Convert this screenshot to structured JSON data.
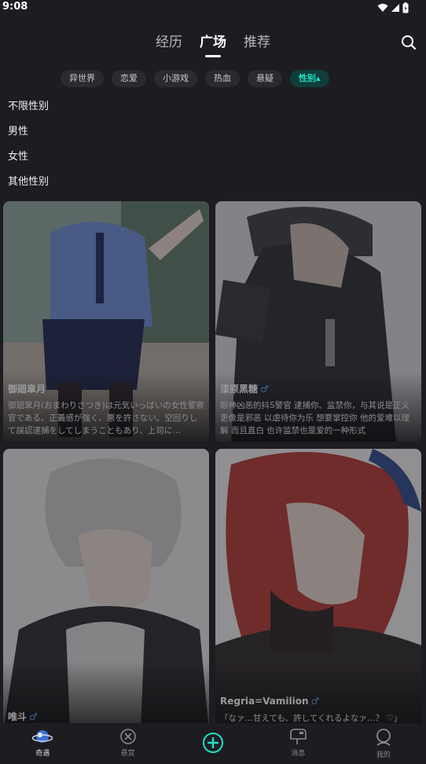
{
  "status": {
    "time": "9:08"
  },
  "tabs": [
    {
      "label": "经历"
    },
    {
      "label": "广场"
    },
    {
      "label": "推荐"
    }
  ],
  "chips": [
    {
      "label": "异世界"
    },
    {
      "label": "恋爱"
    },
    {
      "label": "小游戏"
    },
    {
      "label": "热血"
    },
    {
      "label": "悬疑"
    },
    {
      "label": "性别▴"
    }
  ],
  "gender_menu": {
    "options": [
      "不限性别",
      "男性",
      "女性",
      "其他性别"
    ]
  },
  "cards": [
    {
      "name": "御廻皐月",
      "gender": "",
      "desc": "御廻皐月(おまわりさつき)は元気いっぱいの女性警察官である。正義感が強く、悪を許さない。空回りして誤認逮捕をしてしまうこともあり、上司に…"
    },
    {
      "name": "漆原黑糖",
      "gender": "♂",
      "desc": "眼神凶恶的抖S警官 逮捕你、监禁你，与其说是正义更像是邪恶 以虐待你为乐 想要掌控你 他的爱难以理解 而且直白 也许监禁也是爱的一种形式"
    },
    {
      "name": "唯斗",
      "gender": "♂",
      "desc": ""
    },
    {
      "name": "Regria=Vamilion",
      "gender": "♂",
      "desc": "「なァ…甘えても、許してくれるよなァ…？ ♡」"
    }
  ],
  "bottom_nav": [
    {
      "label": "奇遇",
      "icon": "planet-icon"
    },
    {
      "label": "悬赏",
      "icon": "bounty-icon"
    },
    {
      "label": "",
      "icon": "plus-circle-icon"
    },
    {
      "label": "消息",
      "icon": "mailbox-icon"
    },
    {
      "label": "我的",
      "icon": "profile-icon"
    }
  ],
  "colors": {
    "background": "#1d1c21",
    "accent": "#1fe0c5",
    "chip_bg": "#2b2a30",
    "male": "#54a9ff"
  }
}
